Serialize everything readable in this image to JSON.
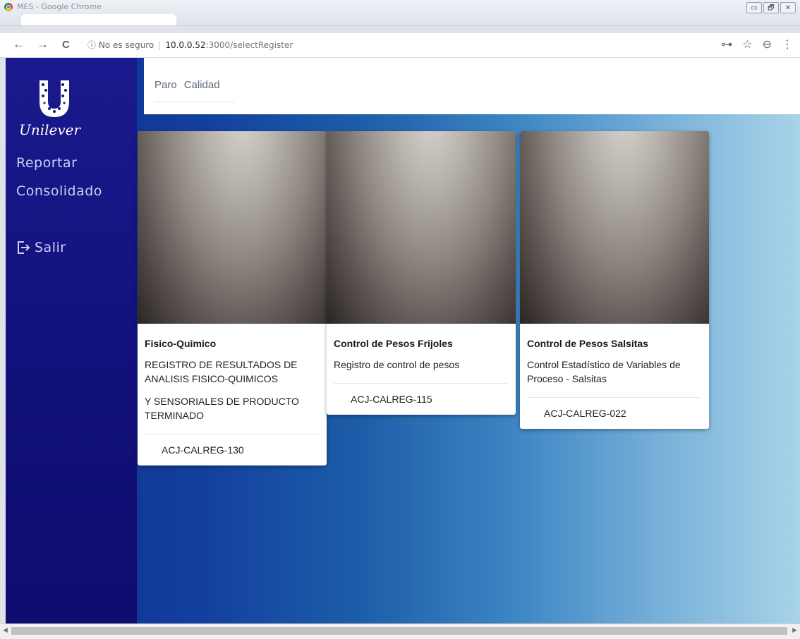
{
  "window": {
    "title": "MES - Google Chrome",
    "controls": [
      "▭",
      "🗗",
      "✕"
    ]
  },
  "toolbar": {
    "back_icon": "←",
    "forward_icon": "→",
    "reload_icon": "C",
    "security_label": "ⓘ No es seguro",
    "url_host": "10.0.0.52",
    "url_path": ":3000/selectRegister",
    "key_icon": "⊶",
    "star_icon": "☆",
    "profile_icon": "⊖",
    "menu_icon": "⋮"
  },
  "sidebar": {
    "logo_text": "Unilever",
    "items": [
      {
        "label": "Reportar"
      },
      {
        "label": "Consolidado"
      }
    ],
    "logout_label": "Salir"
  },
  "topnav": {
    "items": [
      {
        "label": "Paro"
      },
      {
        "label": "Calidad"
      }
    ]
  },
  "cards": [
    {
      "title": "Fisico-Quimico",
      "description_1": "REGISTRO DE RESULTADOS DE ANALISIS FISICO-QUIMICOS",
      "description_2": "Y SENSORIALES DE PRODUCTO TERMINADO",
      "code": "ACJ-CALREG-130"
    },
    {
      "title": "Control de Pesos Frijoles",
      "description_1": "Registro de control de pesos",
      "code": "ACJ-CALREG-115"
    },
    {
      "title": "Control de Pesos Salsitas",
      "description_1": "Control Estadístico de Variables de Proceso - Salsitas",
      "code": "ACJ-CALREG-022"
    }
  ],
  "colors": {
    "sidebar": "#141380",
    "brand_gradient_start": "#0c2b8e",
    "brand_gradient_end": "#a8d3e8"
  }
}
